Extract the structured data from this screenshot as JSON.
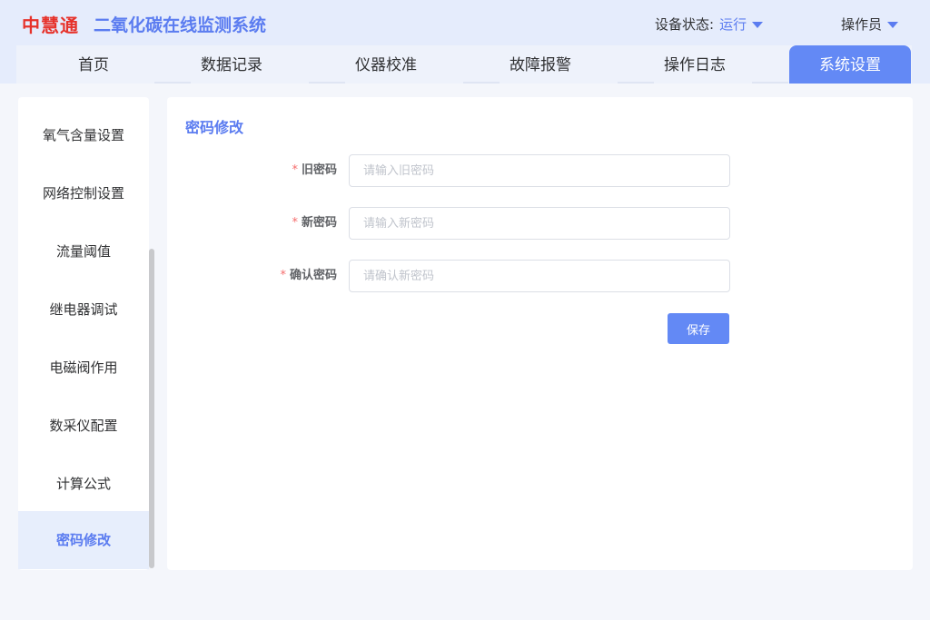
{
  "header": {
    "brand": "中慧通",
    "system_title": "二氧化碳在线监测系统",
    "status_label": "设备状态:",
    "status_value": "运行",
    "user": "操作员"
  },
  "nav": {
    "tabs": [
      {
        "label": "首页"
      },
      {
        "label": "数据记录"
      },
      {
        "label": "仪器校准"
      },
      {
        "label": "故障报警"
      },
      {
        "label": "操作日志"
      },
      {
        "label": "系统设置",
        "active": true
      }
    ]
  },
  "sidebar": {
    "items": [
      {
        "label": "氧气含量设置"
      },
      {
        "label": "网络控制设置"
      },
      {
        "label": "流量阈值"
      },
      {
        "label": "继电器调试"
      },
      {
        "label": "电磁阀作用"
      },
      {
        "label": "数采仪配置"
      },
      {
        "label": "计算公式"
      },
      {
        "label": "密码修改",
        "active": true
      }
    ]
  },
  "main": {
    "title": "密码修改",
    "form": {
      "required_mark": "*",
      "old_password": {
        "label": "旧密码",
        "value": "",
        "placeholder": "请输入旧密码"
      },
      "new_password": {
        "label": "新密码",
        "value": "",
        "placeholder": "请输入新密码"
      },
      "confirm_password": {
        "label": "确认密码",
        "value": "",
        "placeholder": "请确认新密码"
      },
      "save_label": "保存"
    }
  },
  "colors": {
    "accent": "#6389f5",
    "brand": "#e6322b",
    "header_bg": "#e5ecfc",
    "required": "#f56c6c"
  },
  "icons": {
    "status_dropdown": "caret-down-icon",
    "user_dropdown": "caret-down-icon"
  }
}
